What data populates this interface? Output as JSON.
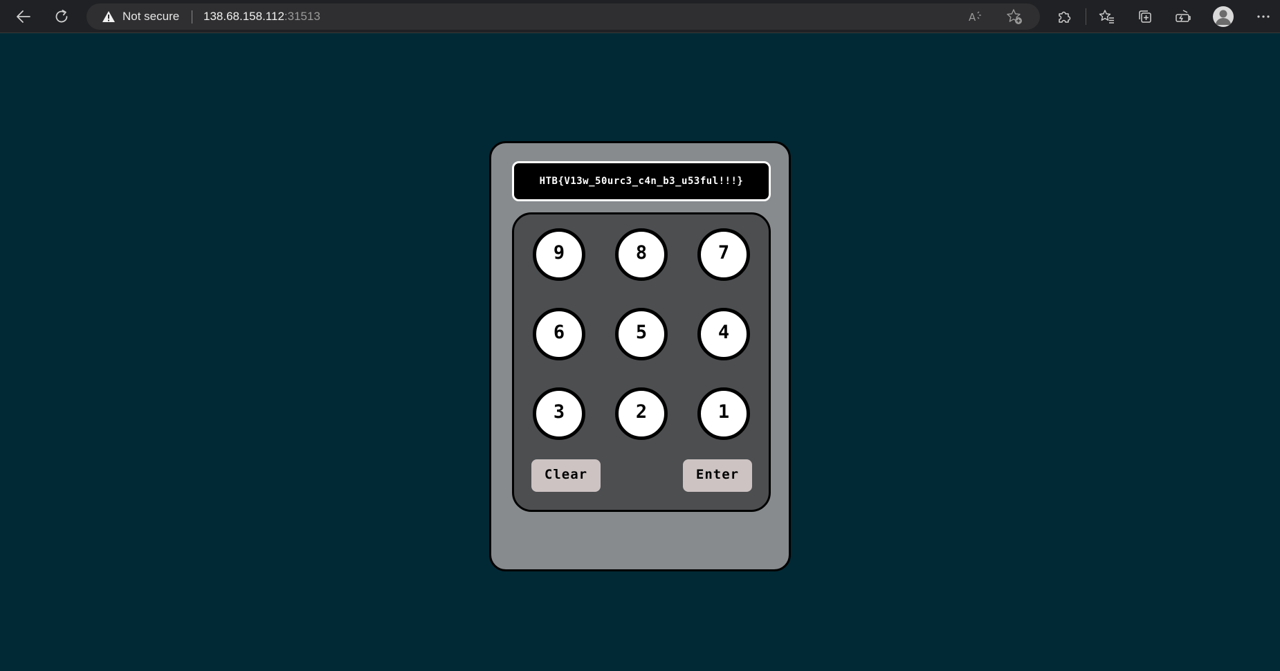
{
  "browser": {
    "security_label": "Not secure",
    "url_host": "138.68.158.112",
    "url_port": ":31513",
    "icons": {
      "back": "arrow-left-icon",
      "refresh": "refresh-icon",
      "warning": "warning-triangle-icon",
      "read_aloud": "read-aloud-icon",
      "add_favorite": "star-plus-icon",
      "extensions": "puzzle-icon",
      "favorites": "favorites-icon",
      "collections": "collections-icon",
      "performance": "performance-icon",
      "profile": "avatar-icon",
      "menu": "more-icon"
    }
  },
  "keypad": {
    "display_text": "HTB{V13w_50urc3_c4n_b3_u53ful!!!}",
    "keys": [
      "9",
      "8",
      "7",
      "6",
      "5",
      "4",
      "3",
      "2",
      "1"
    ],
    "clear_label": "Clear",
    "enter_label": "Enter"
  },
  "colors": {
    "page_background": "#012935",
    "device_body": "#878b8e",
    "pad_background": "#4c4e50",
    "action_button": "#cdc3c3"
  }
}
